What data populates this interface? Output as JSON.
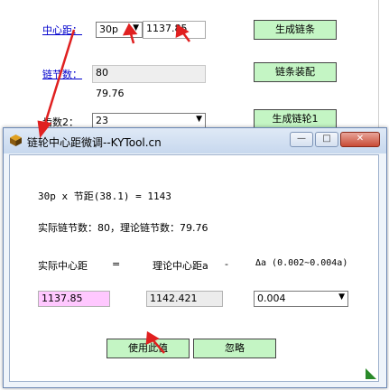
{
  "main": {
    "center_distance_label": "中心距：",
    "pitch_combo_value": "30p",
    "center_distance_value": "1137.85",
    "generate_chain_button": "生成链条",
    "chain_links_label": "链节数：",
    "chain_links_value": "80",
    "chain_links_theory": "79.76",
    "chain_assembly_button": "链条装配",
    "teeth2_label": "齿数2：",
    "teeth2_value": "23",
    "generate_sprocket_button": "生成链轮1"
  },
  "dialog": {
    "title": "链轮中心距微调--KYTool.cn",
    "line_pitch": "30p x 节距(38.1) = 1143",
    "line_links": "实际链节数：80，理论链节数：79.76",
    "col_actual_label": "实际中心距",
    "col_eq": "=",
    "col_theory_label": "理论中心距a",
    "col_minus": "-",
    "col_delta_label": "Δa (0.002~0.004a)",
    "actual_value": "1137.85",
    "theory_value": "1142.421",
    "delta_value": "0.004",
    "use_button": "使用此值",
    "ignore_button": "忽略",
    "min_glyph": "—",
    "max_glyph": "□",
    "close_glyph": "✕"
  },
  "colors": {
    "button_green": "#c4f5c4",
    "highlight_pink": "#ffc8ff",
    "annotation_red": "#e02020"
  }
}
